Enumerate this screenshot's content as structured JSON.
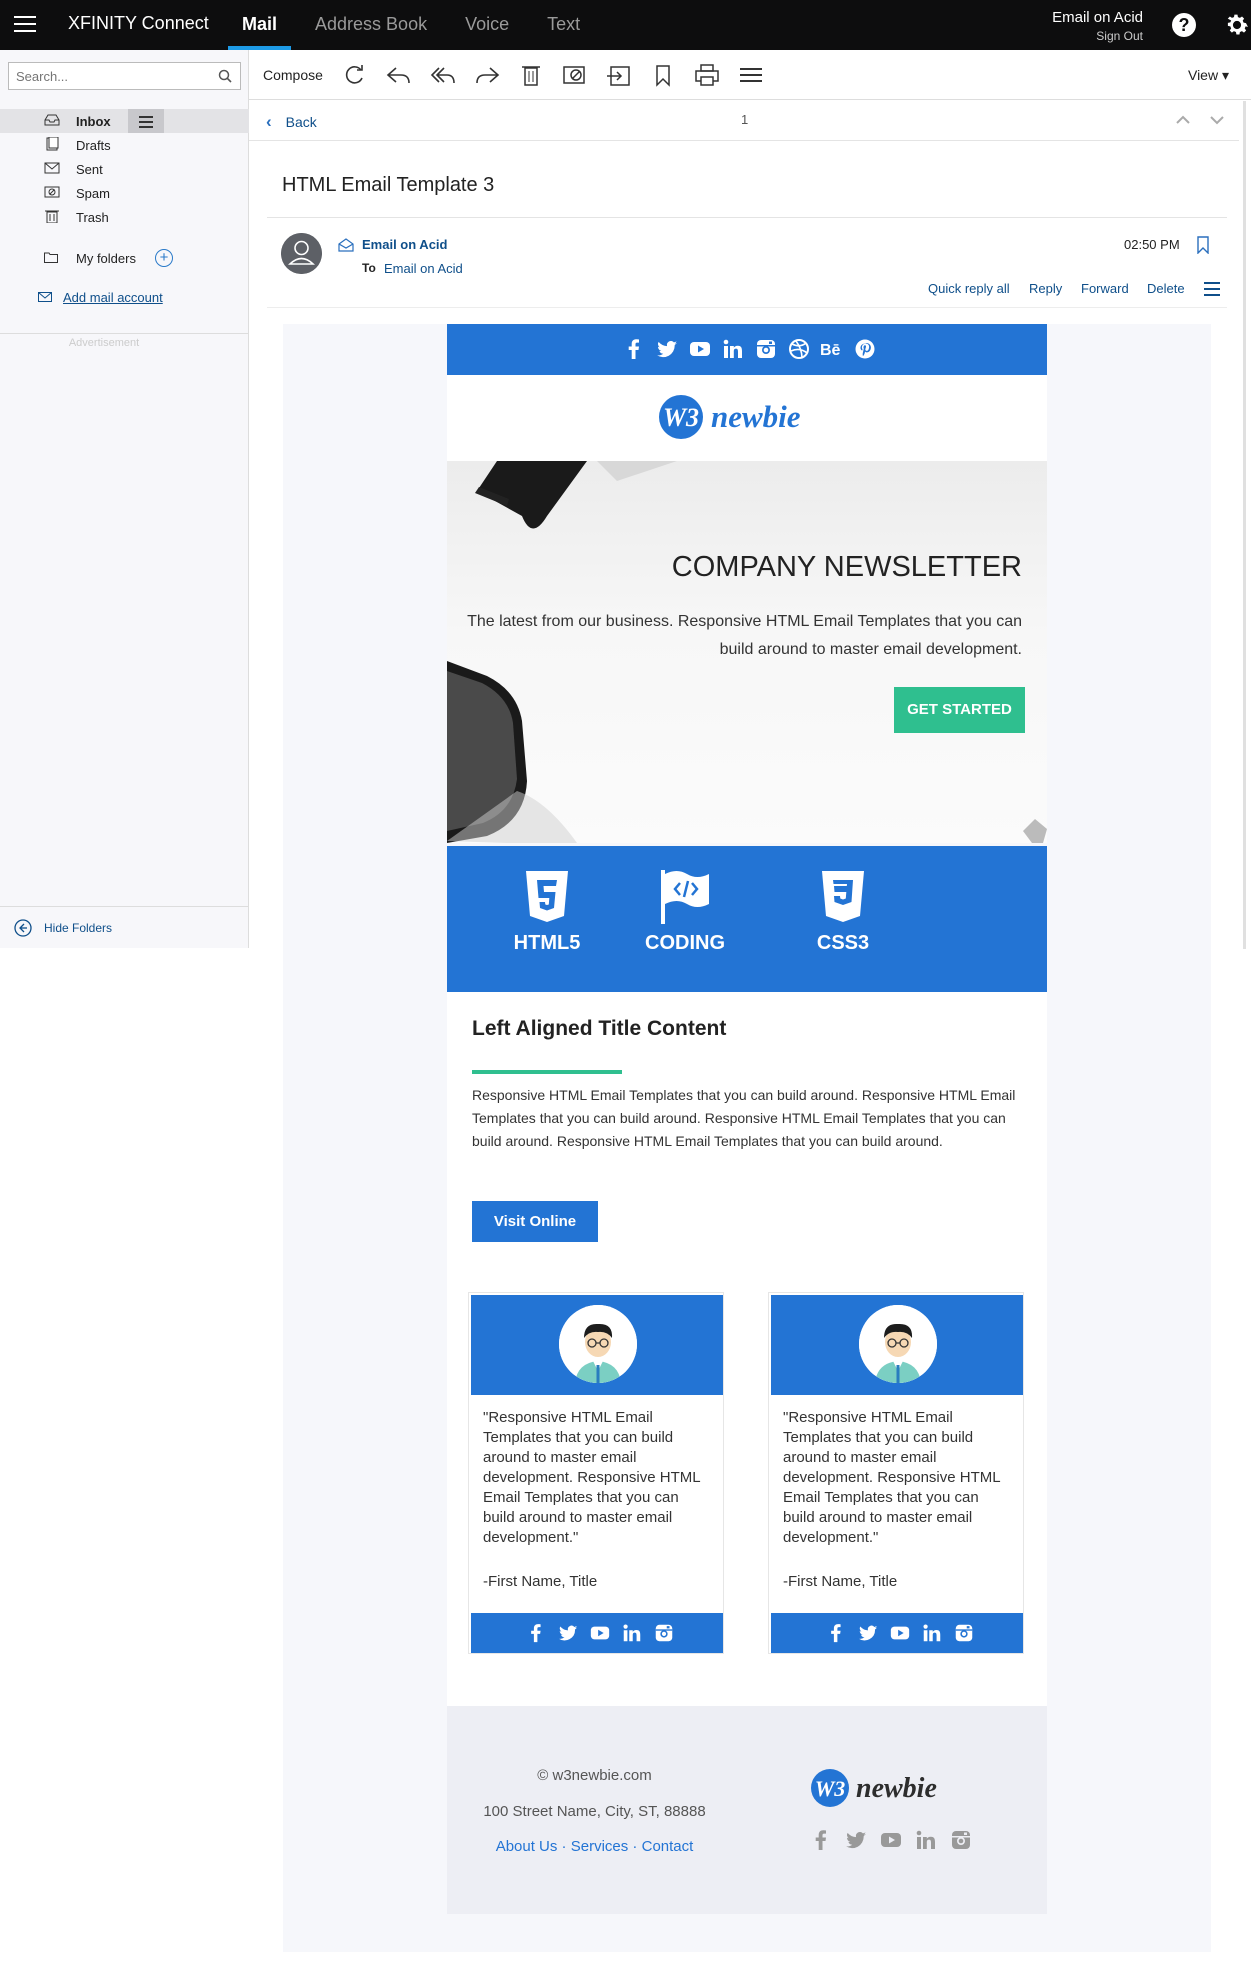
{
  "topbar": {
    "brand": "XFINITY Connect",
    "nav": [
      "Mail",
      "Address Book",
      "Voice",
      "Text"
    ],
    "user_name": "Email on Acid",
    "sign_out": "Sign Out",
    "help_glyph": "?"
  },
  "sidebar": {
    "search_placeholder": "Search...",
    "folders": [
      {
        "label": "Inbox",
        "icon": "inbox-icon"
      },
      {
        "label": "Drafts",
        "icon": "drafts-icon"
      },
      {
        "label": "Sent",
        "icon": "sent-icon"
      },
      {
        "label": "Spam",
        "icon": "spam-icon"
      },
      {
        "label": "Trash",
        "icon": "trash-icon"
      }
    ],
    "my_folders": "My folders",
    "add_mail_account": "Add mail account",
    "advertisement": "Advertisement",
    "hide_folders": "Hide Folders"
  },
  "toolbar": {
    "compose": "Compose",
    "view": "View ▾",
    "icons": [
      "refresh-icon",
      "reply-icon",
      "reply-all-icon",
      "forward-icon",
      "delete-icon",
      "mark-spam-icon",
      "move-icon",
      "bookmark-icon",
      "print-icon",
      "more-icon"
    ]
  },
  "message": {
    "back": "Back",
    "count": "1",
    "subject": "HTML Email Template 3",
    "from": "Email on Acid",
    "to_label": "To",
    "to": "Email on Acid",
    "time": "02:50 PM",
    "actions": [
      "Quick reply all",
      "Reply",
      "Forward",
      "Delete"
    ]
  },
  "email": {
    "brand_logo_text": "W3 newbie",
    "hero": {
      "title": "COMPANY NEWSLETTER",
      "description": "The latest from our business. Responsive HTML Email Templates that you can build around to master email development.",
      "cta": "GET STARTED"
    },
    "features": [
      "HTML5",
      "CODING",
      "CSS3"
    ],
    "section": {
      "title": "Left Aligned Title Content",
      "body": "Responsive HTML Email Templates that you can build around. Responsive HTML Email Templates that you can build around. Responsive HTML Email Templates that you can build around. Responsive HTML Email Templates that you can build around.",
      "button": "Visit Online"
    },
    "testimonials": [
      {
        "quote": "\"Responsive HTML Email Templates that you can build around to master email development. Responsive HTML Email Templates that you can build around to master email development.\"",
        "attribution": "-First Name, Title"
      },
      {
        "quote": "\"Responsive HTML Email Templates that you can build around to master email development. Responsive HTML Email Templates that you can build around to master email development.\"",
        "attribution": "-First Name, Title"
      }
    ],
    "footer": {
      "copyright": "© w3newbie.com",
      "address": "100 Street Name, City, ST, 88888",
      "links": [
        "About Us",
        "Services",
        "Contact"
      ],
      "link_sep": " · "
    },
    "social_icons": [
      "facebook-icon",
      "twitter-icon",
      "youtube-icon",
      "linkedin-icon",
      "instagram-icon",
      "dribbble-icon",
      "behance-icon",
      "pinterest-icon"
    ],
    "colors": {
      "brand_blue": "#2374d4",
      "accent_green": "#2fbf8f"
    }
  }
}
